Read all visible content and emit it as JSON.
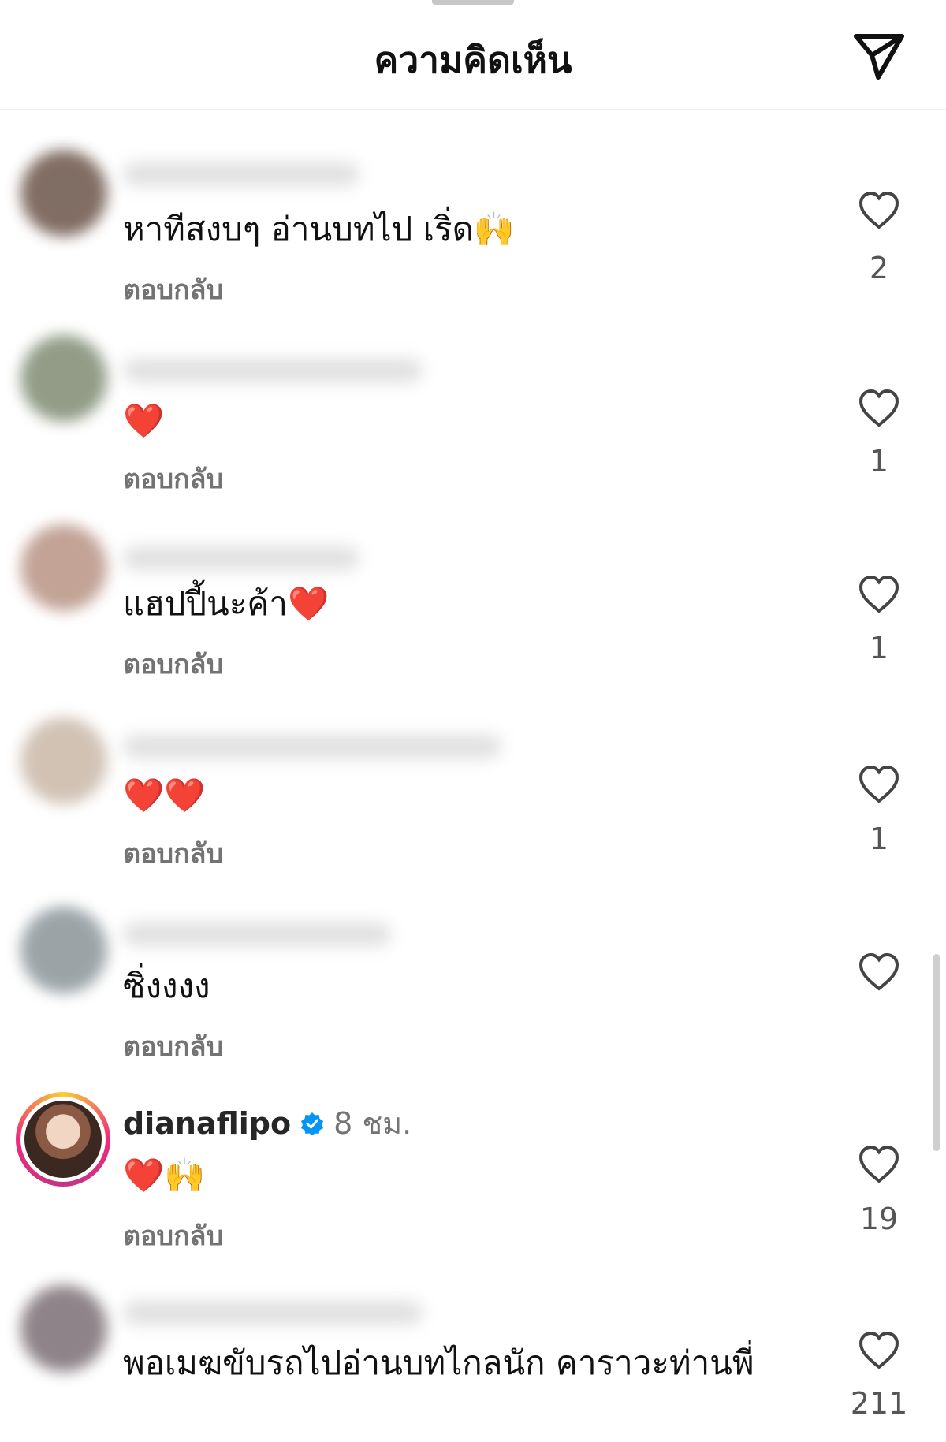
{
  "header": {
    "title": "ความคิดเห็น",
    "send_icon": "paper-plane-icon"
  },
  "comments": [
    {
      "username": "",
      "time": "",
      "text": "หาทีสงบๆ อ่านบทไป เริ่ด🙌",
      "reply": "ตอบกลับ",
      "likes": "2"
    },
    {
      "username": "",
      "time": "",
      "text": "❤️",
      "reply": "ตอบกลับ",
      "likes": "1"
    },
    {
      "username": "",
      "time": "",
      "text": "แฮปปี้นะค้า❤️",
      "reply": "ตอบกลับ",
      "likes": "1"
    },
    {
      "username": "",
      "time": "",
      "text": "❤️❤️",
      "reply": "ตอบกลับ",
      "likes": "1"
    },
    {
      "username": "",
      "time": "",
      "text": "ซิ่งงงง",
      "reply": "ตอบกลับ",
      "likes": ""
    },
    {
      "username": "dianaflipo",
      "time": "8 ชม.",
      "text": "❤️🙌",
      "reply": "ตอบกลับ",
      "likes": "19",
      "verified": true
    },
    {
      "username": "",
      "time": "",
      "text": "พอเมฆขับรถไปอ่านบทไกลนัก คาราวะท่านพี่",
      "reply": "",
      "likes": "211"
    }
  ],
  "colors": {
    "accent_verified": "#0095f6",
    "text_secondary": "#737373",
    "heart": "#e0245e"
  }
}
